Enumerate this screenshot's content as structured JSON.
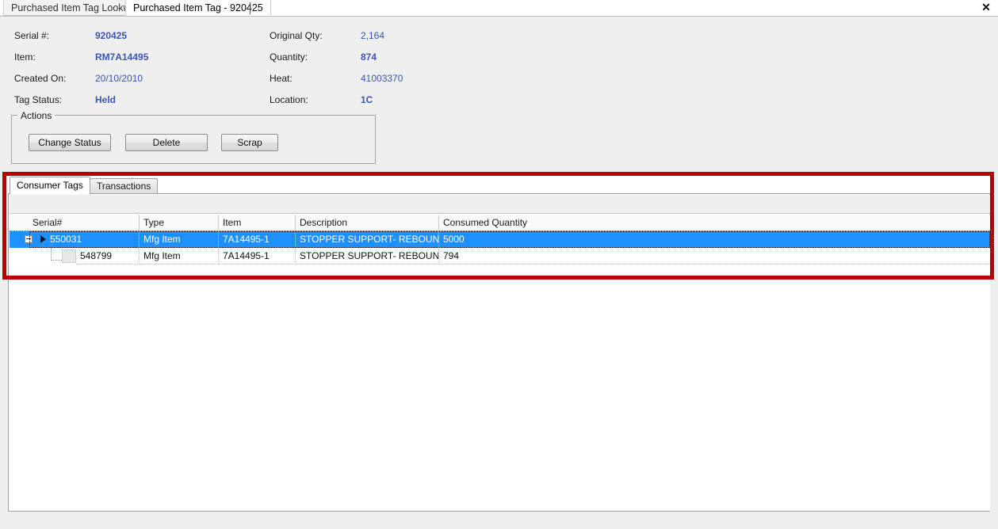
{
  "window": {
    "close_label": "✕"
  },
  "doc_tabs": [
    {
      "label": "Purchased Item Tag Lookup",
      "active": false
    },
    {
      "label": "Purchased Item Tag - 920425",
      "active": true
    }
  ],
  "details": {
    "left": [
      {
        "label": "Serial #:",
        "value": "920425"
      },
      {
        "label": "Item:",
        "value": "RM7A14495"
      },
      {
        "label": "Created On:",
        "value": "20/10/2010"
      },
      {
        "label": "Tag Status:",
        "value": "Held"
      }
    ],
    "right": [
      {
        "label": "Original Qty:",
        "value": "2,164"
      },
      {
        "label": "Quantity:",
        "value": "874"
      },
      {
        "label": "Heat:",
        "value": "41003370"
      },
      {
        "label": "Location:",
        "value": "1C"
      }
    ]
  },
  "actions": {
    "title": "Actions",
    "buttons": [
      {
        "label": "Change Status"
      },
      {
        "label": "Delete"
      },
      {
        "label": "Scrap"
      }
    ]
  },
  "tabs": [
    {
      "label": "Consumer Tags",
      "active": true
    },
    {
      "label": "Transactions",
      "active": false
    }
  ],
  "grid": {
    "columns": [
      {
        "label": "Serial#"
      },
      {
        "label": "Type"
      },
      {
        "label": "Item"
      },
      {
        "label": "Description"
      },
      {
        "label": "Consumed Quantity"
      }
    ],
    "rows": [
      {
        "serial": "550031",
        "type": "Mfg Item",
        "item": "7A14495-1",
        "description": "STOPPER SUPPORT- REBOUND",
        "consumed_quantity": "5000",
        "selected": true,
        "expanded": true,
        "child": false
      },
      {
        "serial": "548799",
        "type": "Mfg Item",
        "item": "7A14495-1",
        "description": "STOPPER SUPPORT- REBOUND",
        "consumed_quantity": "794",
        "selected": false,
        "expanded": false,
        "child": true
      }
    ]
  },
  "colors": {
    "accent_value": "#3b55b5",
    "selection": "#1e90ff",
    "annotation": "#bb0000",
    "chrome": "#efefef"
  }
}
